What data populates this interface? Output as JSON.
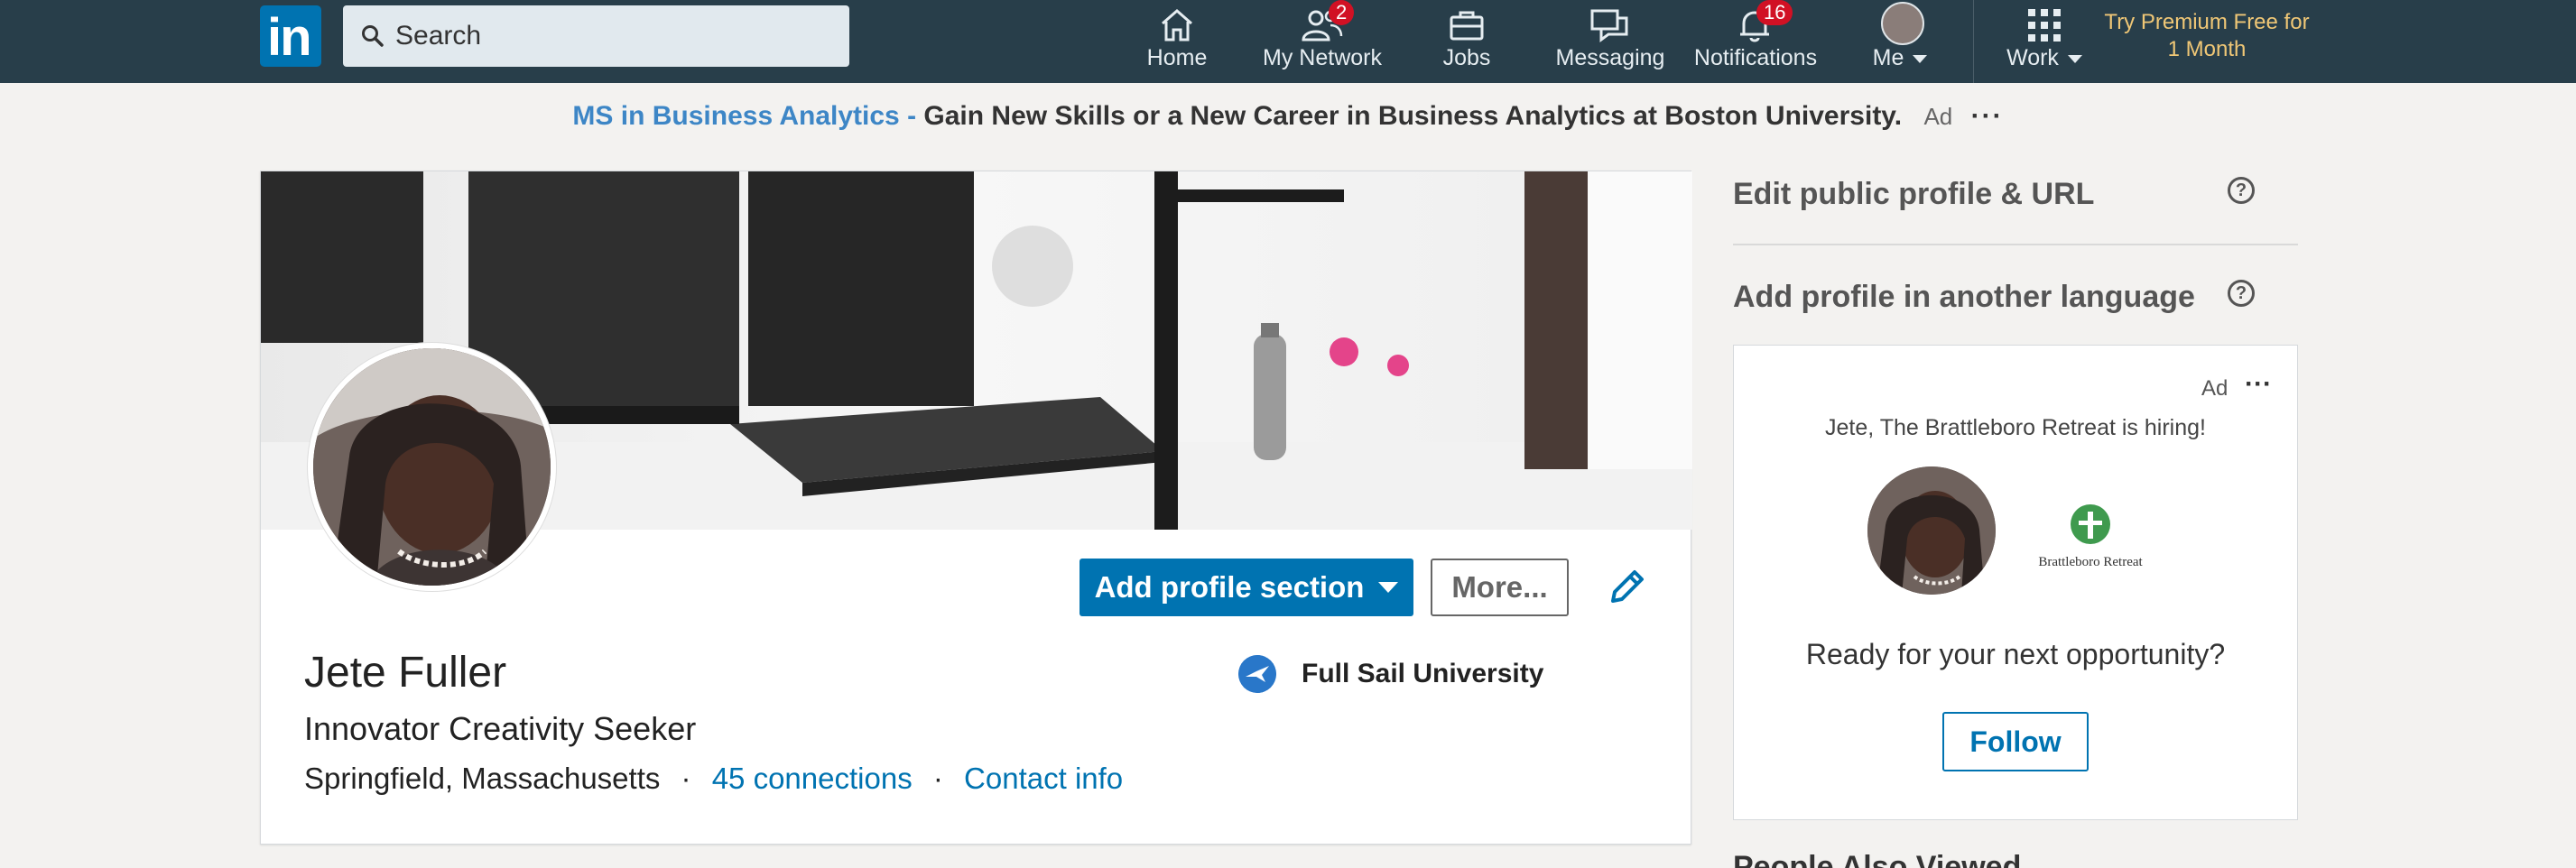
{
  "nav": {
    "search_placeholder": "Search",
    "items": [
      {
        "label": "Home",
        "icon": "home-icon"
      },
      {
        "label": "My Network",
        "icon": "network-icon",
        "badge": "2"
      },
      {
        "label": "Jobs",
        "icon": "briefcase-icon"
      },
      {
        "label": "Messaging",
        "icon": "messaging-icon"
      },
      {
        "label": "Notifications",
        "icon": "bell-icon",
        "badge": "16"
      },
      {
        "label": "Me",
        "icon": "avatar"
      },
      {
        "label": "Work",
        "icon": "grid-icon"
      }
    ],
    "premium": "Try Premium Free for 1 Month",
    "colors": {
      "bar": "#283e4a",
      "badge": "#d11124",
      "premium": "#f0c776"
    }
  },
  "ad": {
    "link_text": "MS in Business Analytics -",
    "text": "Gain New Skills or a New Career in Business Analytics at Boston University.",
    "tag": "Ad",
    "more": "···"
  },
  "profile": {
    "name": "Jete Fuller",
    "headline": "Innovator Creativity Seeker",
    "location": "Springfield, Massachusetts",
    "separator": "·",
    "connections": "45 connections",
    "contact": "Contact info",
    "education": "Full Sail University",
    "add_section": "Add profile section",
    "more": "More..."
  },
  "rail": {
    "edit_public": "Edit public profile & URL",
    "add_language": "Add profile in another language",
    "help": "?",
    "ad_card": {
      "tag": "Ad",
      "more": "···",
      "hiring": "Jete, The Brattleboro Retreat is hiring!",
      "company_logo_text": "Brattleboro Retreat",
      "prompt": "Ready for your next opportunity?",
      "follow": "Follow"
    },
    "people_also_viewed": "People Also Viewed"
  }
}
